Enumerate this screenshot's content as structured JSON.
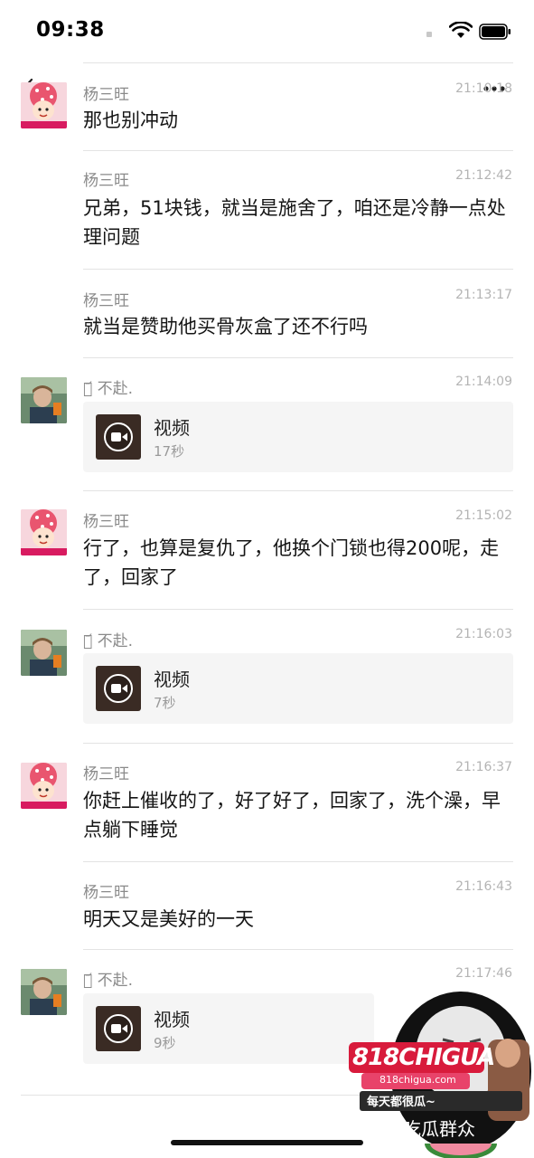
{
  "status_bar": {
    "time": "09:38"
  },
  "messages": [
    {
      "sender": "杨三旺",
      "time": "21:10:18",
      "text": "那也别冲动"
    },
    {
      "sender": "杨三旺",
      "time": "21:12:42",
      "text": "兄弟，51块钱，就当是施舍了，咱还是冷静一点处理问题"
    },
    {
      "sender": "杨三旺",
      "time": "21:13:17",
      "text": "就当是赞助他买骨灰盒了还不行吗"
    },
    {
      "sender": "ᦀ᷄ 不赴.",
      "time": "21:14:09",
      "video_label": "视频",
      "duration": "17秒"
    },
    {
      "sender": "杨三旺",
      "time": "21:15:02",
      "text": "行了，也算是复仇了，他换个门锁也得200呢，走了，回家了"
    },
    {
      "sender": "ᦀ᷄ 不赴.",
      "time": "21:16:03",
      "video_label": "视频",
      "duration": "7秒"
    },
    {
      "sender": "杨三旺",
      "time": "21:16:37",
      "text": "你赶上催收的了，好了好了，回家了，洗个澡，早点躺下睡觉"
    },
    {
      "sender": "杨三旺",
      "time": "21:16:43",
      "text": "明天又是美好的一天"
    },
    {
      "sender": "ᦀ᷄ 不赴.",
      "time": "21:17:46",
      "video_label": "视频",
      "duration": "9秒"
    }
  ],
  "watermark": {
    "logo": "818CHIGUA",
    "url": "818chigua.com",
    "slogan": "每天都很瓜~",
    "caption": "吃瓜群众"
  },
  "colors": {
    "sender": "#8a8a8a",
    "timestamp": "#b4b4b4",
    "video_card": "#f5f5f5",
    "watermark_red": "#d81b3c"
  }
}
